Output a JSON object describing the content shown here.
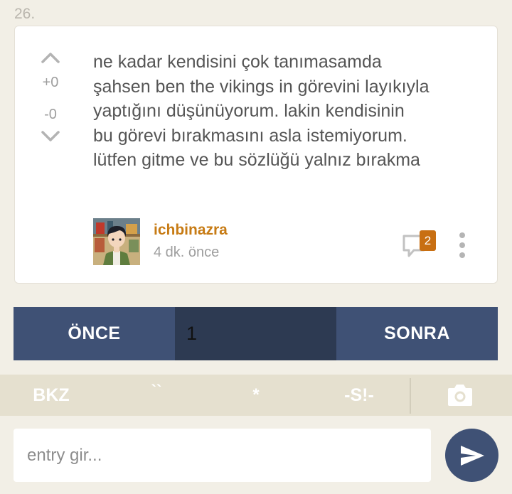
{
  "entry": {
    "number": "26.",
    "votes": {
      "up_count": "+0",
      "down_count": "-0"
    },
    "text_lines": [
      "ne kadar kendisini çok tanımasamda",
      "şahsen ben the vikings in görevini layıkıyla",
      "yaptığını düşünüyorum. lakin kendisinin",
      "bu görevi bırakmasını asla istemiyorum.",
      "lütfen gitme ve bu sözlüğü yalnız bırakma"
    ],
    "author": "ichbinazra",
    "timestamp": "4 dk. önce",
    "comment_count": "2",
    "comment_icon": "comment-bubble-icon",
    "more_icon": "more-vertical-icon"
  },
  "pager": {
    "prev_label": "ÖNCE",
    "page_value": "1",
    "next_label": "SONRA"
  },
  "toolbar": {
    "bkz_label": "BKZ",
    "tick_label": "``",
    "star_label": "*",
    "spoiler_label": "-S!-",
    "camera_icon": "camera-icon"
  },
  "composer": {
    "placeholder": "entry gir...",
    "send_icon": "send-icon"
  },
  "colors": {
    "background": "#f2efe6",
    "nav_blue": "#3f5175",
    "nav_page": "#2d3a52",
    "author_orange": "#c77b14",
    "badge_orange": "#c86f12",
    "toolbar_beige": "#e5e0cf"
  }
}
